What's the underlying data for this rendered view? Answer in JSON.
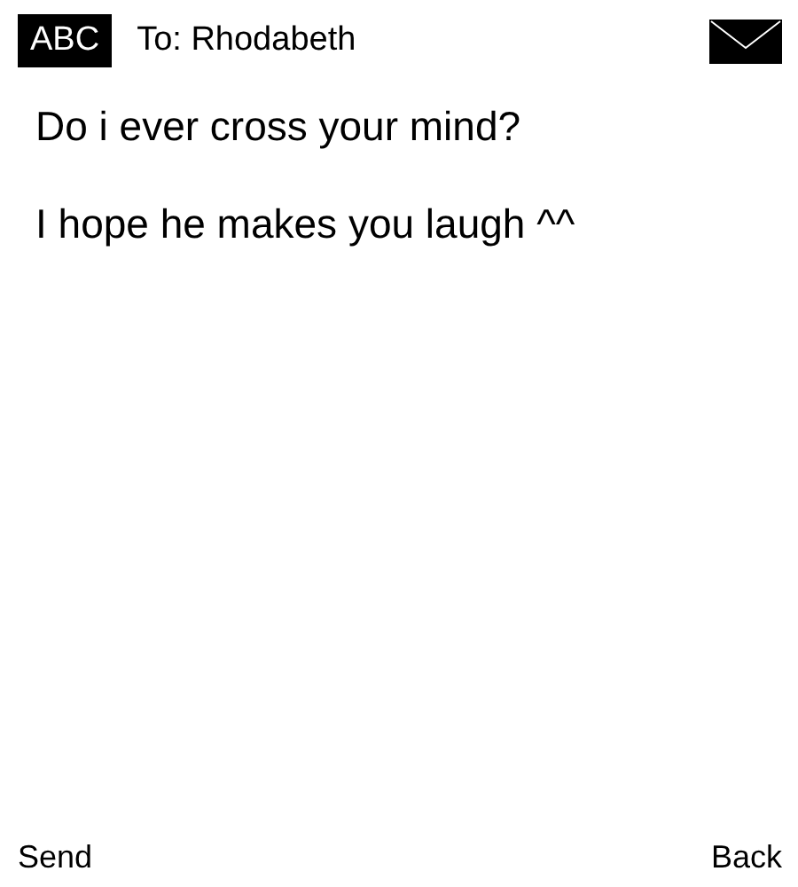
{
  "header": {
    "input_mode": "ABC",
    "recipient": "To: Rhodabeth"
  },
  "message_lines": [
    "Do i ever cross your mind?",
    "I hope he makes you laugh ^^"
  ],
  "softkeys": {
    "left": "Send",
    "right": "Back"
  }
}
